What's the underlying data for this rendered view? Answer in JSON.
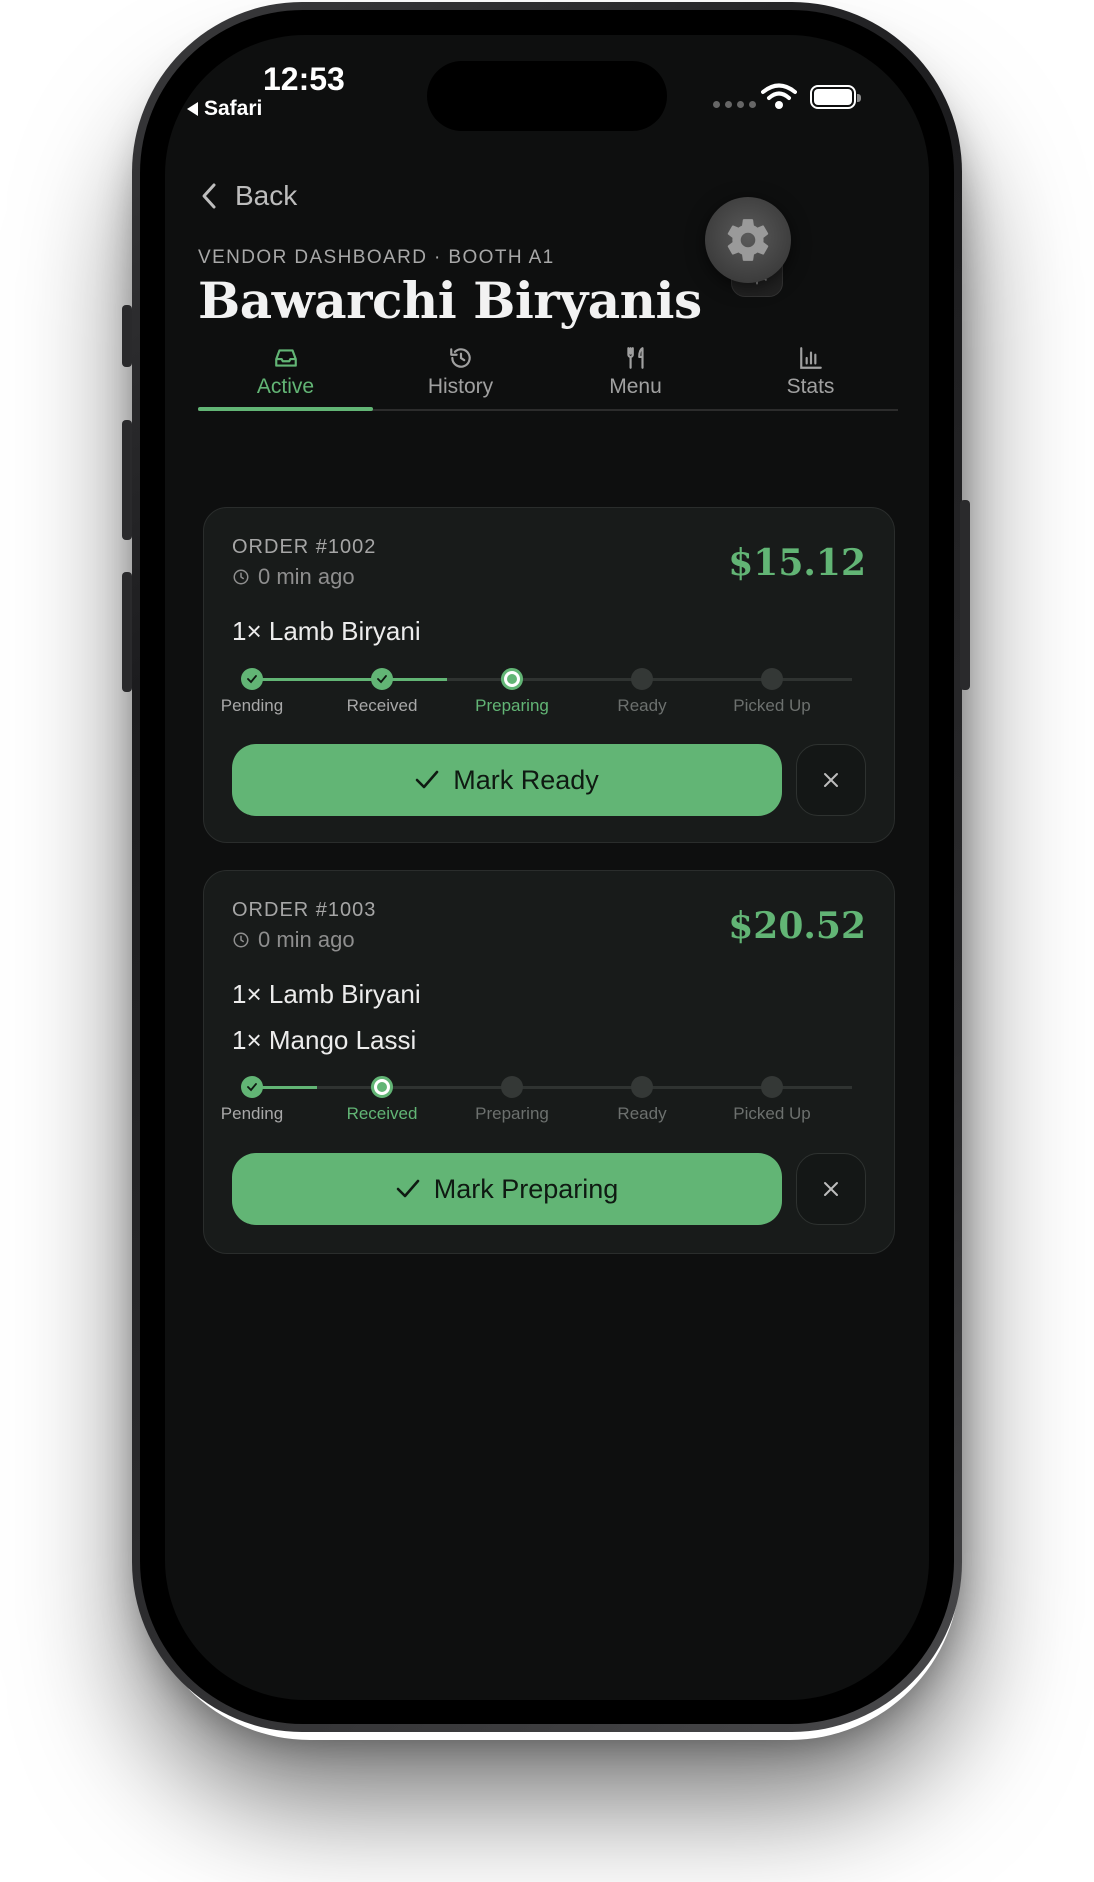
{
  "status_bar": {
    "time": "12:53",
    "back_app": "Safari"
  },
  "header": {
    "back_label": "Back",
    "subtitle": "VENDOR DASHBOARD · BOOTH A1",
    "title": "Bawarchi Biryanis"
  },
  "tabs": [
    {
      "label": "Active",
      "icon": "inbox-icon",
      "active": true
    },
    {
      "label": "History",
      "icon": "history-icon",
      "active": false
    },
    {
      "label": "Menu",
      "icon": "utensils-icon",
      "active": false
    },
    {
      "label": "Stats",
      "icon": "bar-chart-icon",
      "active": false
    }
  ],
  "steps": [
    "Pending",
    "Received",
    "Preparing",
    "Ready",
    "Picked Up"
  ],
  "orders": [
    {
      "number": "ORDER #1002",
      "time": "0 min ago",
      "price": "$15.12",
      "items": [
        "1× Lamb Biryani"
      ],
      "current_step": 2,
      "action_label": "Mark Ready"
    },
    {
      "number": "ORDER #1003",
      "time": "0 min ago",
      "price": "$20.52",
      "items": [
        "1× Lamb Biryani",
        "1× Mango Lassi"
      ],
      "current_step": 1,
      "action_label": "Mark Preparing"
    }
  ],
  "colors": {
    "accent": "#62b575",
    "background": "#0e0f0f",
    "card": "#181b1a"
  }
}
